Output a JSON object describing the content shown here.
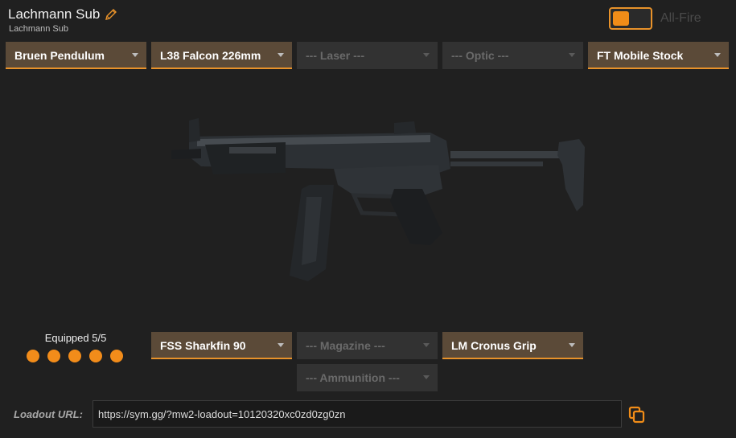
{
  "header": {
    "weapon_name": "Lachmann Sub",
    "weapon_subtitle": "Lachmann Sub"
  },
  "toggle": {
    "label": "All-Fire",
    "enabled": true
  },
  "slots_top": [
    {
      "value": "Bruen Pendulum",
      "active": true
    },
    {
      "value": "L38 Falcon 226mm",
      "active": true
    },
    {
      "value": "--- Laser ---",
      "active": false
    },
    {
      "value": "--- Optic ---",
      "active": false
    },
    {
      "value": "FT Mobile Stock",
      "active": true
    }
  ],
  "slots_bottom": [
    {
      "value": "FSS Sharkfin 90",
      "active": true
    },
    {
      "value": "--- Magazine ---",
      "active": false
    },
    {
      "value": "LM Cronus Grip",
      "active": true
    },
    {
      "value": "--- Ammunition ---",
      "active": false
    }
  ],
  "equipped": {
    "label": "Equipped 5/5",
    "count": 5,
    "max": 5
  },
  "loadout": {
    "label": "Loadout URL:",
    "url": "https://sym.gg/?mw2-loadout=10120320xc0zd0zg0zn"
  },
  "colors": {
    "accent": "#f08c18",
    "background": "#202020",
    "active_slot": "#5b4a38",
    "inactive_slot": "#323232"
  },
  "icons": {
    "edit": "pencil-icon",
    "copy": "copy-icon"
  }
}
